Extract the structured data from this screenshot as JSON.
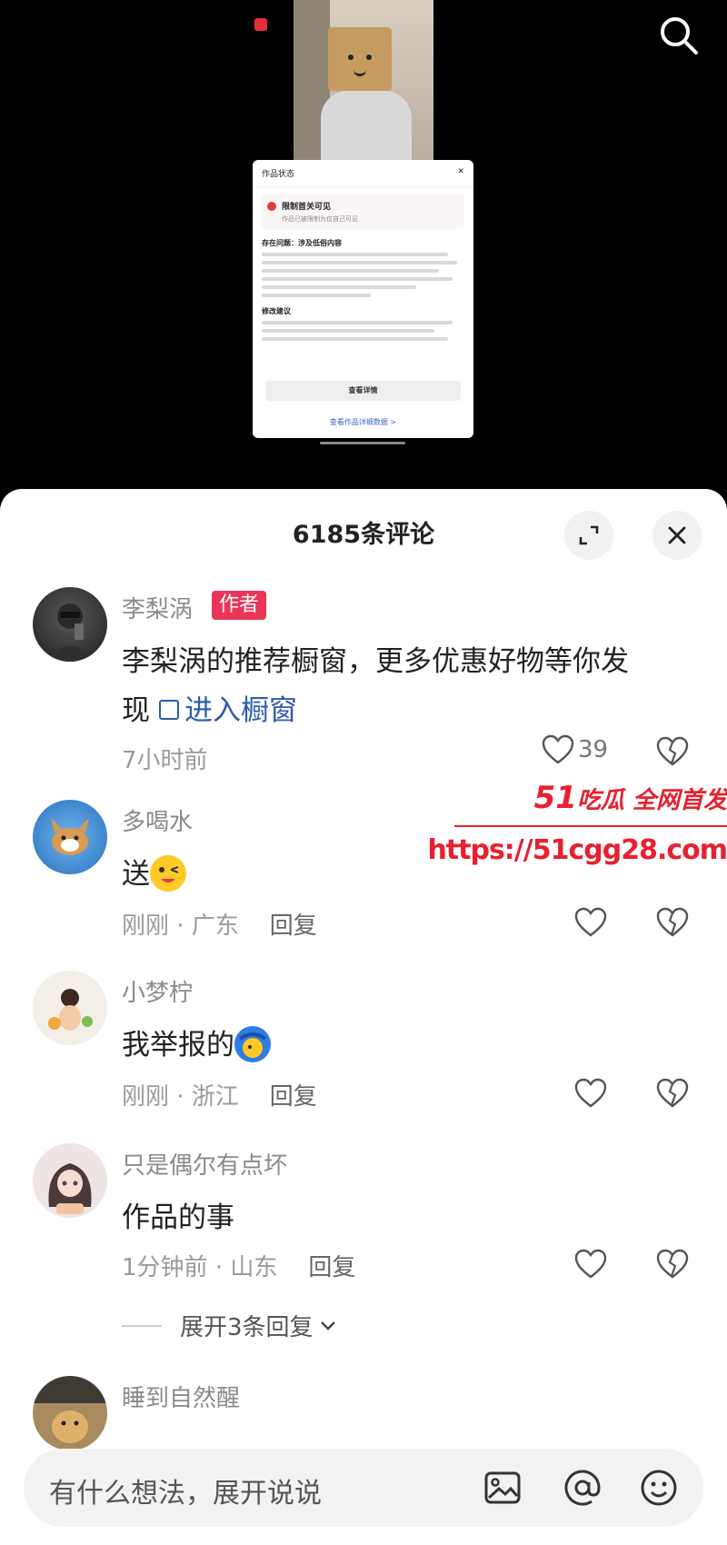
{
  "sheet": {
    "title": "6185条评论"
  },
  "popup": {
    "header": "作品状态",
    "alert_title": "限制首关可见",
    "alert_sub": "作品已被限制为仅自己可见",
    "problem_title": "存在问题：涉及低俗内容",
    "suggest_title": "修改建议",
    "button": "查看详情",
    "link": "查看作品详细数据 >"
  },
  "comments": [
    {
      "name": "李梨涡",
      "tag": "作者",
      "text_line1": "李梨涡的推荐橱窗，更多优惠好物等你发",
      "text_line2": "现",
      "shop_link": "进入橱窗",
      "meta": "7小时前",
      "likes": "39"
    },
    {
      "name": "多喝水",
      "text": "送",
      "meta": "刚刚 · 广东",
      "reply": "回复"
    },
    {
      "name": "小梦柠",
      "text": "我举报的",
      "meta": "刚刚 · 浙江",
      "reply": "回复"
    },
    {
      "name": "只是偶尔有点坏",
      "text": "作品的事",
      "meta": "1分钟前 · 山东",
      "reply": "回复",
      "expand": "展开3条回复"
    },
    {
      "name": "睡到自然醒"
    }
  ],
  "watermark": {
    "brand_num": "51",
    "brand_text": "吃瓜 全网首发",
    "url": "https://51cgg28.com"
  },
  "input": {
    "placeholder": "有什么想法，展开说说"
  },
  "icons": [
    "search-icon",
    "expand-icon",
    "close-icon",
    "heart-icon",
    "dislike-heart-icon",
    "shop-icon",
    "image-icon",
    "at-icon",
    "emoji-icon",
    "chevron-down-icon"
  ],
  "colors": {
    "author_tag": "#ea3557",
    "link": "#2d5ca8",
    "watermark": "#e8202f"
  }
}
